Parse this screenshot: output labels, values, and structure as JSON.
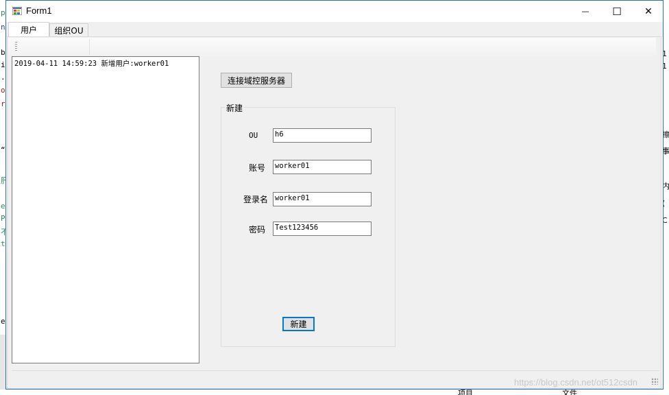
{
  "window": {
    "title": "Form1",
    "minimize_glyph": "—",
    "maximize_glyph": "☐",
    "close_glyph": "✕"
  },
  "tabs": [
    {
      "label": "用户",
      "selected": true
    },
    {
      "label": "组织OU",
      "selected": false
    }
  ],
  "log": {
    "lines": [
      "2019-04-11 14:59:23 新增用户:worker01"
    ]
  },
  "connect_button": {
    "label": "连接域控服务器"
  },
  "group": {
    "title": "新建",
    "fields": [
      {
        "label": "OU",
        "value": "h6"
      },
      {
        "label": "账号",
        "value": "worker01"
      },
      {
        "label": "登录名",
        "value": "worker01"
      },
      {
        "label": "密码",
        "value": "Test123456"
      }
    ],
    "create_button": "新建"
  },
  "background": {
    "left_chars": [
      "p",
      "n",
      "b",
      "i",
      ".",
      "o",
      "r",
      "“",
      "肝",
      "e",
      "P",
      "不",
      "t",
      "e"
    ],
    "right_chars": [
      "1",
      "1",
      "擦",
      "事",
      "内",
      "(",
      "C"
    ],
    "bottom_texts": [
      "项目",
      "文件"
    ]
  },
  "watermark": "https://blog.csdn.net/ot512csdn",
  "colors": {
    "accent": "#0078d7",
    "window_border": "#2b6fb6"
  }
}
